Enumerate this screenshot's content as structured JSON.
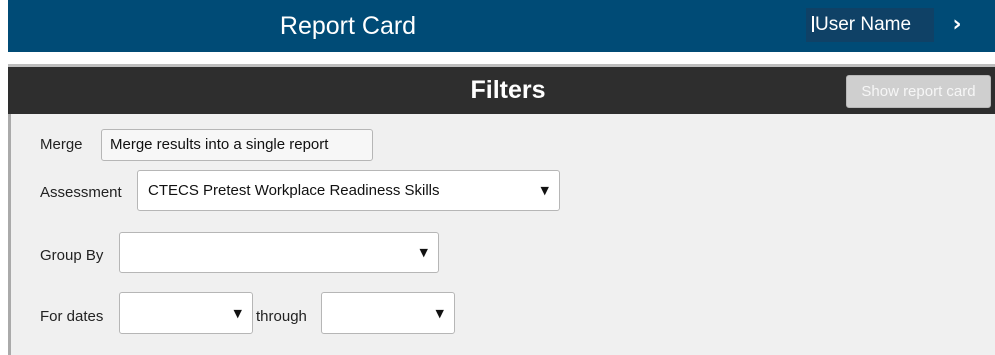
{
  "header": {
    "title": "Report Card",
    "user_name": "User Name",
    "chevron_icon": "chevron-right-icon"
  },
  "filters": {
    "title": "Filters",
    "show_button": "Show report card",
    "merge": {
      "label": "Merge",
      "button": "Merge results into a single report"
    },
    "assessment": {
      "label": "Assessment",
      "value": "CTECS Pretest Workplace Readiness Skills"
    },
    "group_by": {
      "label": "Group By",
      "value": ""
    },
    "dates": {
      "label": "For dates",
      "from_value": "",
      "through_label": "through",
      "through_value": ""
    }
  },
  "colors": {
    "header_bg": "#004b76",
    "filters_bg": "#2e2e2e",
    "panel_bg": "#f0f0f0"
  }
}
